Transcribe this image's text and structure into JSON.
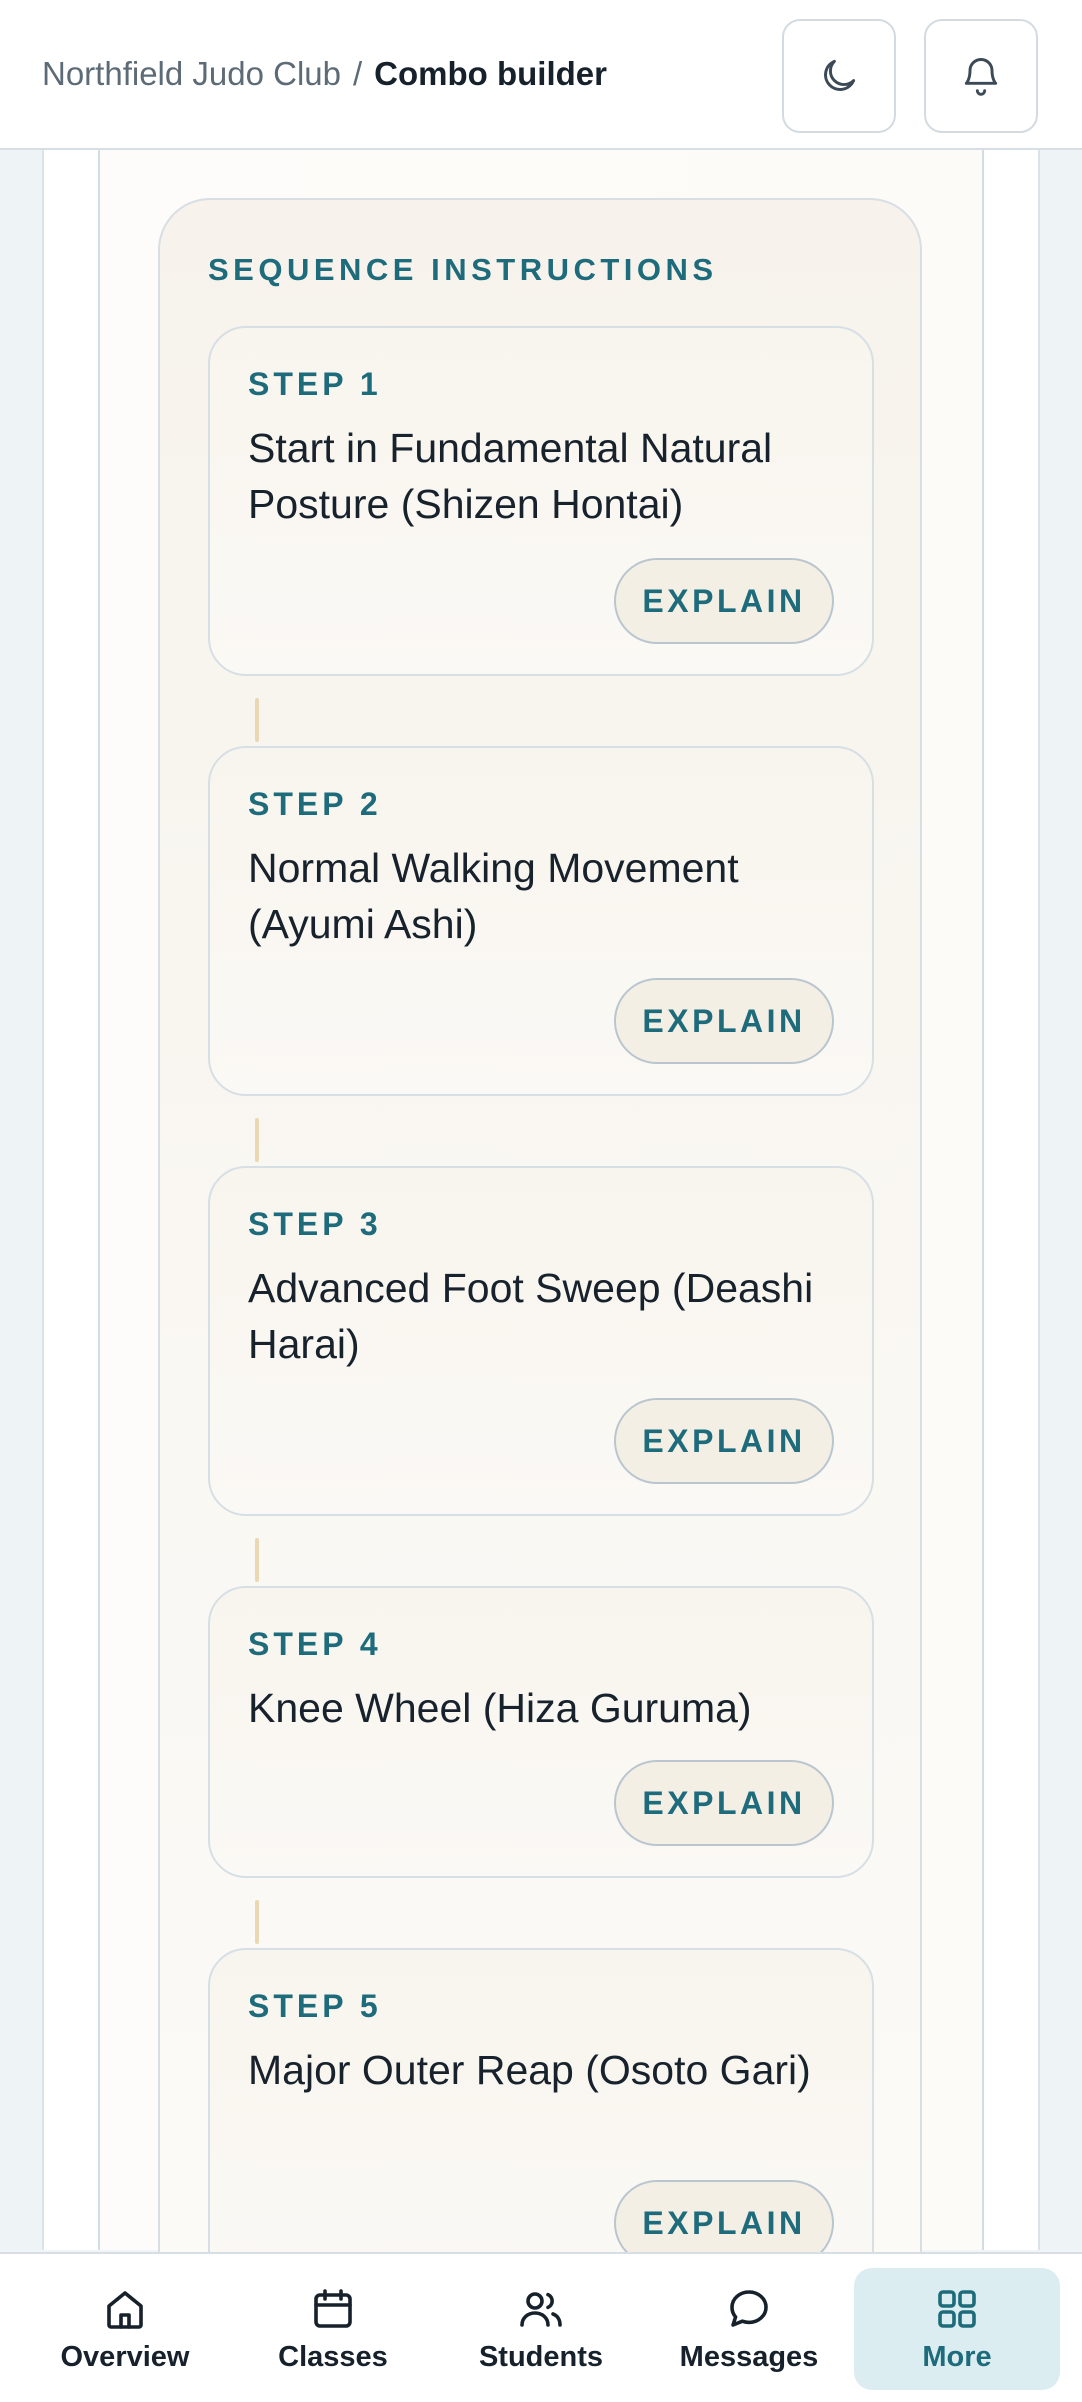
{
  "header": {
    "club_name": "Northfield Judo Club",
    "separator": "/",
    "page_title": "Combo builder",
    "theme_icon": "moon-icon",
    "notification_icon": "bell-icon"
  },
  "sequence": {
    "title": "SEQUENCE INSTRUCTIONS",
    "steps": [
      {
        "label": "STEP 1",
        "text": "Start in Fundamental Natural Posture (Shizen Hontai)",
        "button": "EXPLAIN"
      },
      {
        "label": "STEP 2",
        "text": "Normal Walking Movement (Ayumi Ashi)",
        "button": "EXPLAIN"
      },
      {
        "label": "STEP 3",
        "text": "Advanced Foot Sweep (Deashi Harai)",
        "button": "EXPLAIN"
      },
      {
        "label": "STEP 4",
        "text": "Knee Wheel (Hiza Guruma)",
        "button": "EXPLAIN"
      },
      {
        "label": "STEP 5",
        "text": "Major Outer Reap (Osoto Gari)",
        "button": "EXPLAIN"
      }
    ]
  },
  "nav": {
    "items": [
      {
        "label": "Overview",
        "icon": "home-icon"
      },
      {
        "label": "Classes",
        "icon": "calendar-icon"
      },
      {
        "label": "Students",
        "icon": "users-icon"
      },
      {
        "label": "Messages",
        "icon": "chat-icon"
      },
      {
        "label": "More",
        "icon": "grid-icon",
        "active": true
      }
    ]
  },
  "colors": {
    "accent": "#1d6b7b",
    "panel_bg": "#f8f5ee",
    "active_nav_bg": "#dbedf0"
  }
}
